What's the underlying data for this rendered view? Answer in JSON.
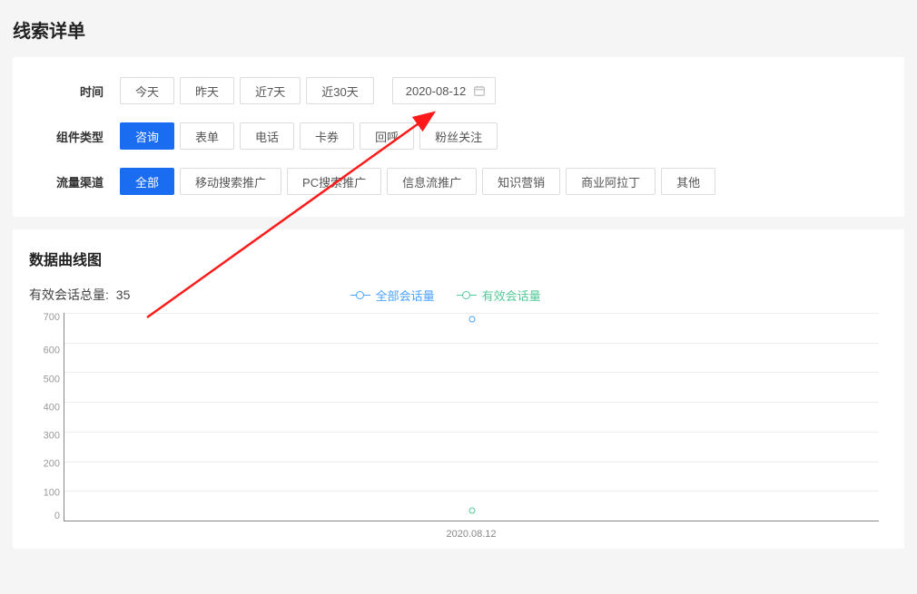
{
  "page_title": "线索详单",
  "filters": {
    "time": {
      "label": "时间",
      "options": [
        "今天",
        "昨天",
        "近7天",
        "近30天"
      ],
      "active": null,
      "date_value": "2020-08-12"
    },
    "component_type": {
      "label": "组件类型",
      "options": [
        "咨询",
        "表单",
        "电话",
        "卡券",
        "回呼",
        "粉丝关注"
      ],
      "active": 0
    },
    "channel": {
      "label": "流量渠道",
      "options": [
        "全部",
        "移动搜索推广",
        "PC搜索推广",
        "信息流推广",
        "知识营销",
        "商业阿拉丁",
        "其他"
      ],
      "active": 0
    }
  },
  "chart_section": {
    "title": "数据曲线图",
    "summary_label": "有效会话总量:",
    "summary_value": "35",
    "legend": {
      "all": "全部会话量",
      "valid": "有效会话量"
    }
  },
  "chart_data": {
    "type": "line",
    "categories": [
      "2020.08.12"
    ],
    "series": [
      {
        "name": "全部会话量",
        "values": [
          680
        ],
        "color": "#4aa3ff"
      },
      {
        "name": "有效会话量",
        "values": [
          35
        ],
        "color": "#55c99a"
      }
    ],
    "ylim": [
      0,
      700
    ],
    "yticks": [
      0,
      100,
      200,
      300,
      400,
      500,
      600,
      700
    ],
    "xlabel": "",
    "ylabel": "",
    "title": ""
  }
}
